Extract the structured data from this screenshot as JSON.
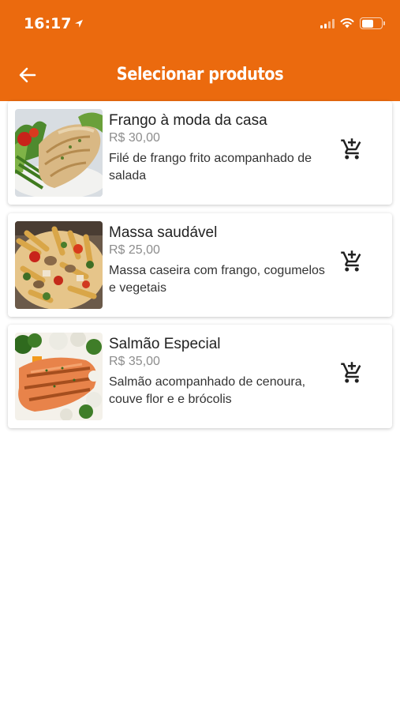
{
  "status_bar": {
    "time": "16:17"
  },
  "header": {
    "title": "Selecionar produtos",
    "background_color": "#eb6a0e",
    "back_icon": "arrow-left-icon"
  },
  "products": [
    {
      "name": "Frango à moda da casa",
      "price": "R$ 30,00",
      "description": "Filé de frango frito acompanhado de salada",
      "image": "chicken-salad-image",
      "action_icon": "add-to-cart-icon"
    },
    {
      "name": "Massa saudável",
      "price": "R$ 25,00",
      "description": "Massa caseira com frango, cogumelos e vegetais",
      "image": "pasta-image",
      "action_icon": "add-to-cart-icon"
    },
    {
      "name": "Salmão Especial",
      "price": "R$ 35,00",
      "description": "Salmão acompanhado de cenoura, couve flor e e brócolis",
      "image": "salmon-vegetables-image",
      "action_icon": "add-to-cart-icon"
    }
  ]
}
